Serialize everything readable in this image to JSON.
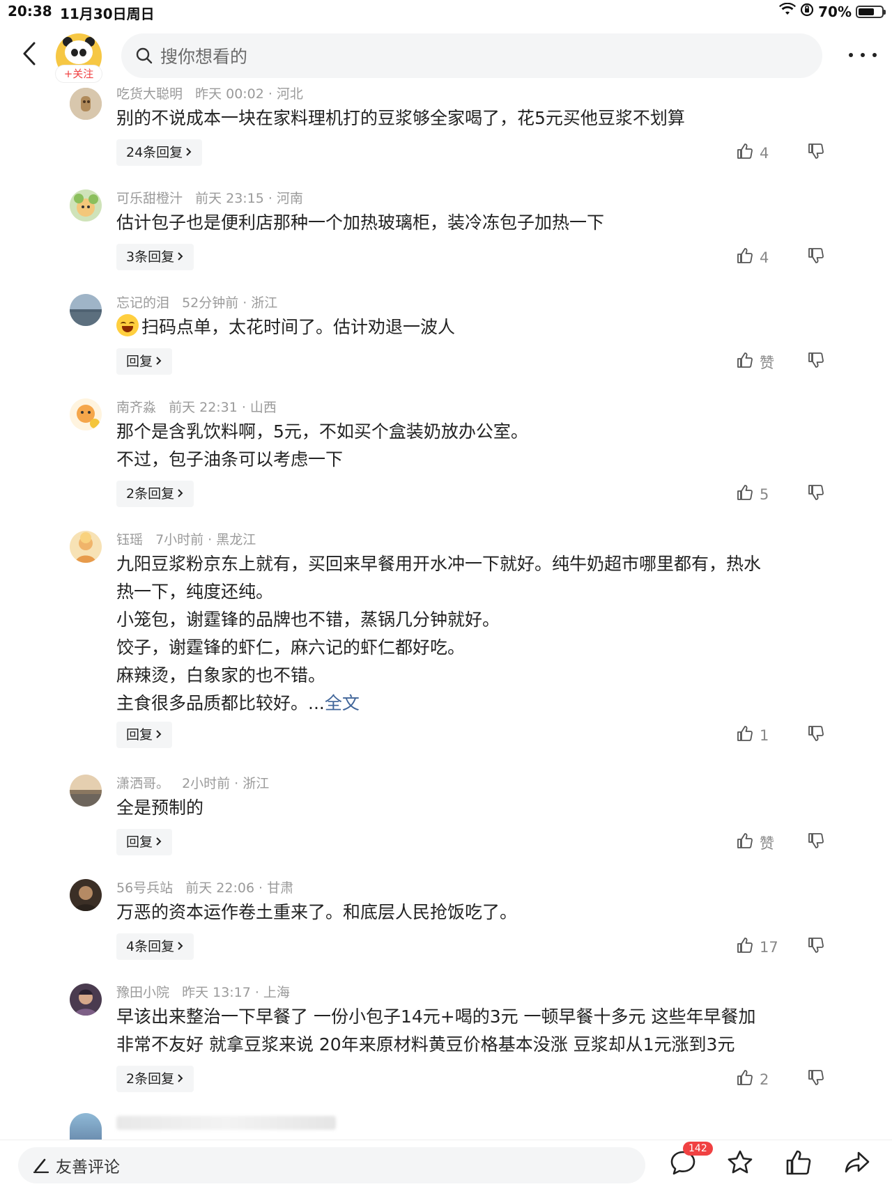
{
  "status_bar": {
    "time": "20:38",
    "date": "11月30日周日",
    "battery": "70%",
    "battery_level": 0.7
  },
  "header": {
    "follow_label": "+关注",
    "search_placeholder": "搜你想看的"
  },
  "comments": [
    {
      "user": "吃货大聪明",
      "time": "昨天 00:02",
      "location": "河北",
      "lines": [
        "别的不说成本一块在家料理机打的豆浆够全家喝了，花5元买他豆浆不划算"
      ],
      "replies": "24条回复",
      "likes": "4"
    },
    {
      "user": "可乐甜橙汁",
      "time": "前天 23:15",
      "location": "河南",
      "lines": [
        "估计包子也是便利店那种一个加热玻璃柜，装冷冻包子加热一下"
      ],
      "replies": "3条回复",
      "likes": "4"
    },
    {
      "user": "忘记的泪",
      "time": "52分钟前",
      "location": "浙江",
      "lines": [
        "扫码点单，太花时间了。估计劝退一波人"
      ],
      "emoji": "laugh-cry-emoji",
      "replies": "回复",
      "likes": "赞"
    },
    {
      "user": "南齐淼",
      "time": "前天 22:31",
      "location": "山西",
      "lines": [
        "那个是含乳饮料啊，5元，不如买个盒装奶放办公室。",
        "不过，包子油条可以考虑一下"
      ],
      "replies": "2条回复",
      "likes": "5"
    },
    {
      "user": "钰瑶",
      "time": "7小时前",
      "location": "黑龙江",
      "lines": [
        "九阳豆浆粉京东上就有，买回来早餐用开水冲一下就好。纯牛奶超市哪里都有，热水",
        "热一下，纯度还纯。",
        "小笼包，谢霆锋的品牌也不错，蒸锅几分钟就好。",
        "饺子，谢霆锋的虾仁，麻六记的虾仁都好吃。",
        "麻辣烫，白象家的也不错。",
        "主食很多品质都比较好。..."
      ],
      "fulltext": "全文",
      "replies": "回复",
      "likes": "1"
    },
    {
      "user": "潇洒哥。",
      "time": "2小时前",
      "location": "浙江",
      "lines": [
        "全是预制的"
      ],
      "replies": "回复",
      "likes": "赞"
    },
    {
      "user": "56号兵站",
      "time": "前天 22:06",
      "location": "甘肃",
      "lines": [
        "万恶的资本运作卷土重来了。和底层人民抢饭吃了。"
      ],
      "replies": "4条回复",
      "likes": "17"
    },
    {
      "user": "豫田小院",
      "time": "昨天 13:17",
      "location": "上海",
      "lines": [
        "早该出来整治一下早餐了 一份小包子14元+喝的3元 一顿早餐十多元 这些年早餐加",
        "非常不友好 就拿豆浆来说 20年来原材料黄豆价格基本没涨 豆浆却从1元涨到3元"
      ],
      "replies": "2条回复",
      "likes": "2"
    }
  ],
  "bottom_bar": {
    "comment_placeholder": "友善评论",
    "comment_count": "142"
  }
}
